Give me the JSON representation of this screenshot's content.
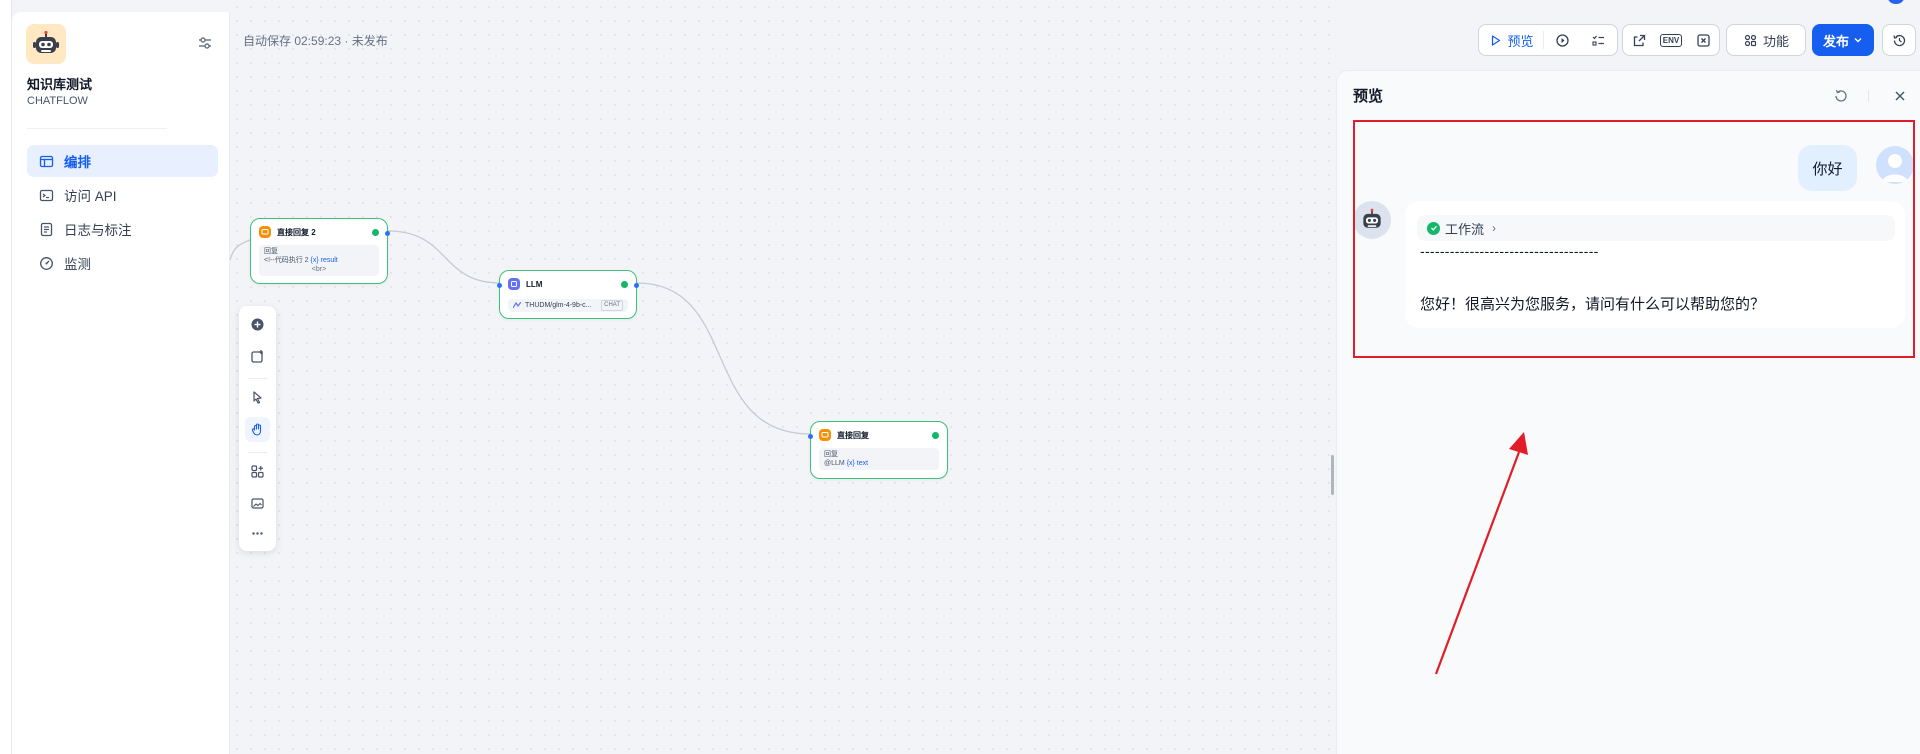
{
  "app": {
    "name": "知识库测试",
    "type": "CHATFLOW"
  },
  "sidebar": {
    "items": [
      {
        "label": "编排",
        "icon": "layout-icon",
        "active": true
      },
      {
        "label": "访问 API",
        "icon": "terminal-icon"
      },
      {
        "label": "日志与标注",
        "icon": "log-icon"
      },
      {
        "label": "监测",
        "icon": "gauge-icon"
      }
    ]
  },
  "canvas": {
    "autosave": "自动保存 02:59:23 · 未发布",
    "nodes": {
      "answer2": {
        "title": "直接回复 2",
        "body_label": "回复",
        "body_text": "<!--代码执行 2",
        "var": "{x} result",
        "br": "<br>"
      },
      "llm": {
        "title": "LLM",
        "model": "THUDM/glm-4-9b-c...",
        "badge": "CHAT"
      },
      "answer": {
        "title": "直接回复",
        "body_label": "回复",
        "body_prefix": "@LLM",
        "var": "{x} text"
      }
    }
  },
  "toolbar": {
    "preview": "预览",
    "features": "功能",
    "publish": "发布",
    "env": "ENV"
  },
  "preview": {
    "title": "预览",
    "user_message": "你好",
    "workflow_tag": "工作流",
    "dashes": "------------------------------------",
    "answer": "您好！很高兴为您服务，请问有什么可以帮助您的？"
  },
  "colors": {
    "accent": "#155eef",
    "success": "#12b76a",
    "annotation": "#e11d2a"
  }
}
